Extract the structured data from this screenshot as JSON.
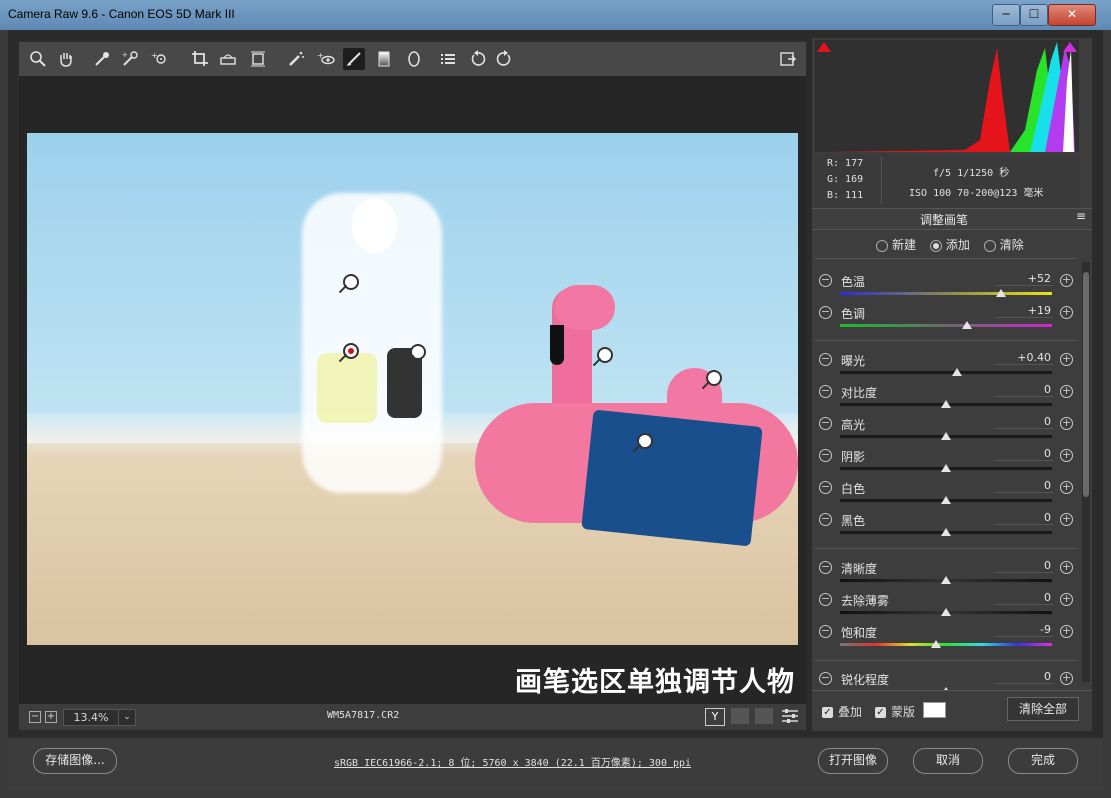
{
  "window": {
    "title": "Camera Raw 9.6 -  Canon EOS 5D Mark III",
    "minimize": "─",
    "maximize": "☐",
    "close": "✕"
  },
  "toolbar": {
    "tools": [
      "zoom-icon",
      "hand-icon",
      "white-balance-icon",
      "color-sampler-icon",
      "targeted-adjustment-icon",
      "crop-icon",
      "straighten-icon",
      "transform-icon",
      "spot-removal-icon",
      "red-eye-icon",
      "adjustment-brush-icon",
      "graduated-filter-icon",
      "radial-filter-icon",
      "preferences-icon",
      "rotate-left-icon",
      "rotate-right-icon"
    ],
    "fullscreen_icon": "fullscreen-icon"
  },
  "canvas": {
    "overlay_text": "画笔选区单独调节人物"
  },
  "statusbar": {
    "zoom": "13.4%",
    "filename": "WM5A7817.CR2"
  },
  "bottom": {
    "save_label": "存储图像...",
    "workflow_link": "sRGB IEC61966-2.1; 8 位; 5760 x 3840 (22.1 百万像素); 300 ppi",
    "open_label": "打开图像",
    "cancel_label": "取消",
    "done_label": "完成"
  },
  "info": {
    "r": "R:  177",
    "g": "G:  169",
    "b": "B:  111",
    "aperture": "f/5   1/1250 秒",
    "iso": "ISO 100   70-200@123 毫米"
  },
  "panel": {
    "title": "调整画笔",
    "modes": [
      "新建",
      "添加",
      "清除"
    ],
    "sliders": [
      {
        "label": "色温",
        "value": "+52",
        "pos": 0.76
      },
      {
        "label": "色调",
        "value": "+19",
        "pos": 0.6
      },
      {
        "label": "曝光",
        "value": "+0.40",
        "pos": 0.55
      },
      {
        "label": "对比度",
        "value": "0",
        "pos": 0.5
      },
      {
        "label": "高光",
        "value": "0",
        "pos": 0.5
      },
      {
        "label": "阴影",
        "value": "0",
        "pos": 0.5
      },
      {
        "label": "白色",
        "value": "0",
        "pos": 0.5
      },
      {
        "label": "黑色",
        "value": "0",
        "pos": 0.5
      },
      {
        "label": "清晰度",
        "value": "0",
        "pos": 0.5
      },
      {
        "label": "去除薄雾",
        "value": "0",
        "pos": 0.5
      },
      {
        "label": "饱和度",
        "value": "-9",
        "pos": 0.455
      },
      {
        "label": "锐化程度",
        "value": "0",
        "pos": 0.5
      }
    ],
    "overlay_label": "叠加",
    "mask_label": "蒙版",
    "clear_all": "清除全部"
  }
}
